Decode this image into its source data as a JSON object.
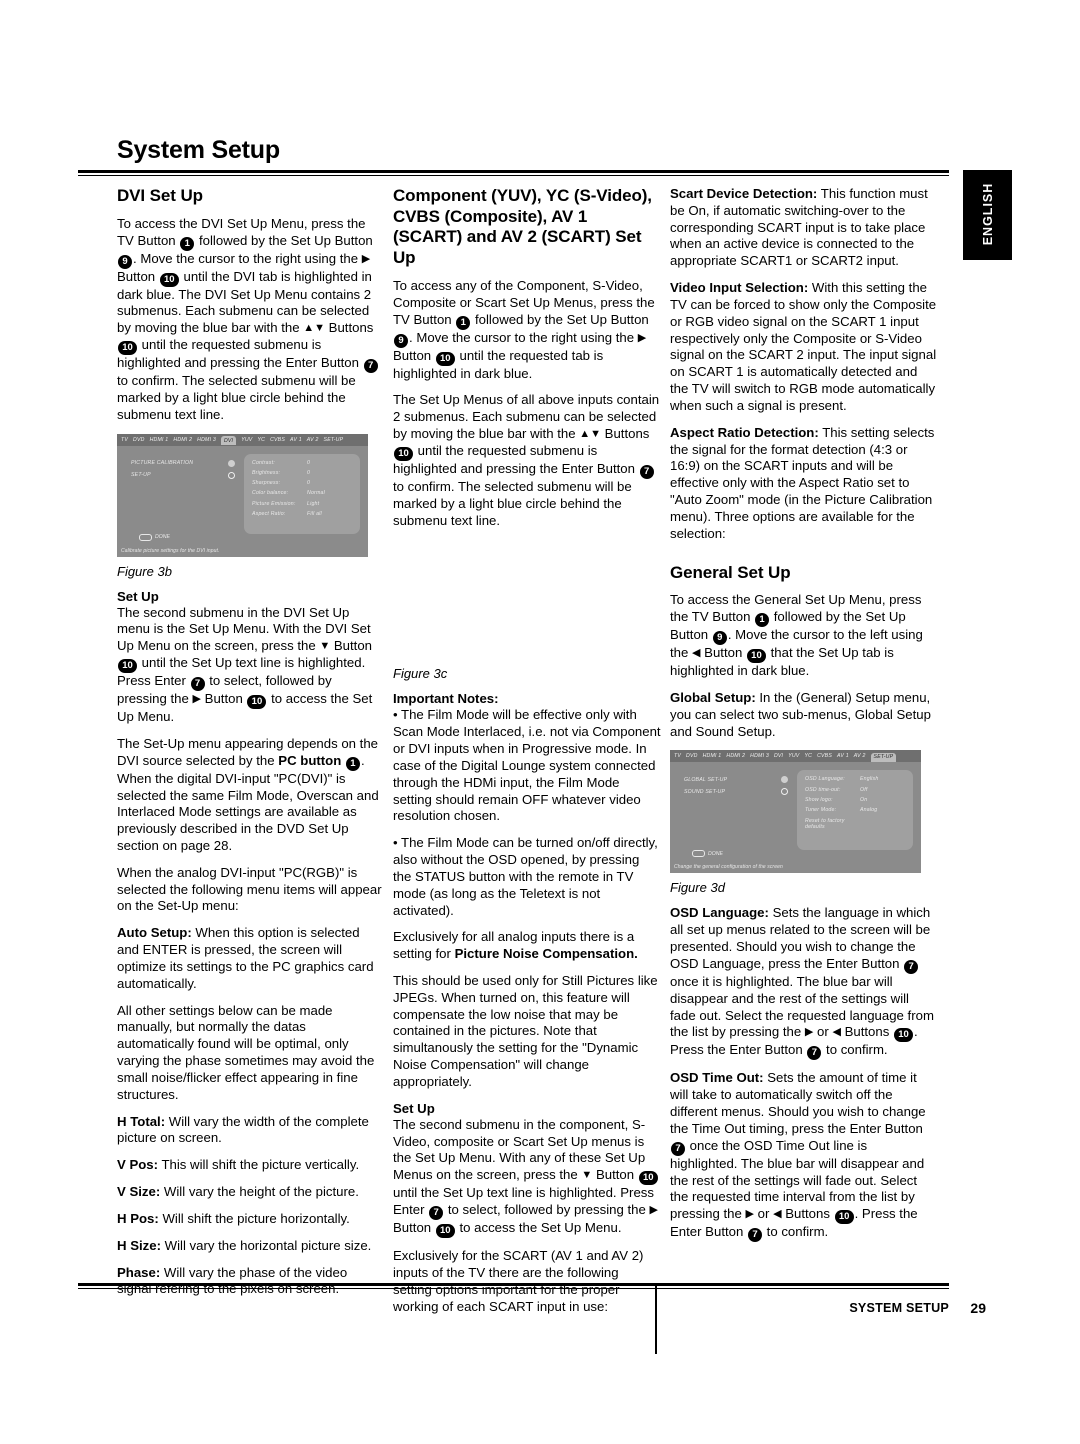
{
  "header": {
    "title": "System Setup",
    "language_tab": "ENGLISH"
  },
  "footer": {
    "label": "SYSTEM SETUP",
    "page_number": "29"
  },
  "column1": {
    "heading": "DVI Set Up",
    "p1_a": "To access the DVI Set Up Menu, press the TV Button",
    "p1_b": "followed by the Set Up Button",
    "p1_c": ". Move the cursor to the right using the",
    "p1_d": "Button",
    "p1_e": "until the DVI tab is highlighted in dark blue. The DVI Set Up Menu contains 2 submenus. Each submenu can be selected by moving the blue bar with the",
    "p1_f": "Buttons",
    "p1_g": "until the requested submenu is highlighted and pressing the Enter Button",
    "p1_h": "to confirm. The selected submenu will be marked by a light blue circle behind the submenu text line.",
    "figure_caption": "Figure 3b",
    "sub1_heading": "Set Up",
    "sub1_a": "The second submenu in the DVI Set Up menu is the Set Up Menu. With the DVI Set Up Menu on the screen, press the",
    "sub1_b": "Button",
    "sub1_c": "until the Set Up text line is highlighted. Press Enter",
    "sub1_d": "to select, followed by pressing the",
    "sub1_e": "Button",
    "sub1_f": "to access the Set Up Menu.",
    "p2_a": "The Set-Up menu appearing depends on the DVI source selected by the",
    "p2_bold": "PC button",
    "p2_b": ". When the digital DVI-input \"PC(DVI)\" is selected the same Film Mode, Overscan and Interlaced Mode settings are available as previously described in the DVD Set Up section on page 28.",
    "p3": "When the analog DVI-input \"PC(RGB)\" is selected the following menu items will appear on the Set-Up menu:",
    "p4_bold": "Auto Setup:",
    "p4": "When this option is selected and ENTER is pressed, the screen will optimize its settings to the PC graphics card automatically.",
    "p5": "All other settings below can be made manually, but normally the datas automatically found will be optimal, only varying the phase sometimes may avoid the small noise/flicker effect appearing in fine structures.",
    "p6_bold": "H Total:",
    "p6": "Will vary the width of the complete picture on screen.",
    "p7_bold": "V Pos:",
    "p7": "This will shift the picture vertically.",
    "p8_bold": "V Size:",
    "p8": "Will vary the height of the picture.",
    "p9_bold": "H Pos:",
    "p9": "Will shift the picture horizontally.",
    "p10_bold": "H Size:",
    "p10": "Will vary the horizontal picture size.",
    "p11_bold": "Phase:",
    "p11": "Will vary the phase of the video signal refering to the pixels on screen."
  },
  "column2": {
    "heading": "Component (YUV), YC (S-Video), CVBS (Composite), AV 1 (SCART) and AV 2 (SCART) Set Up",
    "p1_a": "To access any of the Component, S-Video, Composite or Scart Set Up Menus, press the TV Button",
    "p1_b": "followed by the Set Up Button",
    "p1_c": ". Move the cursor to the right using the",
    "p1_d": "Button",
    "p1_e": "until the requested tab is highlighted in dark blue.",
    "p2_a": "The Set Up Menus of all above inputs contain 2 submenus. Each submenu can be selected by moving the blue bar with the",
    "p2_b": "Buttons",
    "p2_c": "until the requested submenu is highlighted and pressing the Enter Button",
    "p2_d": "to confirm. The selected submenu will be marked by a light blue circle behind the submenu text line.",
    "figure_caption": "Figure 3c",
    "notes_heading": "Important Notes:",
    "note1": "• The Film Mode will be effective only with Scan Mode Interlaced, i.e. not via Component or DVI inputs when in Progressive mode. In case of the Digital Lounge system connected through the HDMi input, the Film Mode setting should remain OFF whatever video resolution chosen.",
    "note2": "• The Film Mode can be turned on/off directly, also without the OSD opened, by pressing the STATUS button with the remote in TV mode (as long as the Teletext is not activated).",
    "p3_a": "Exclusively for all analog inputs there is a setting for",
    "p3_bold": "Picture Noise Compensation.",
    "p4": "This should be used only for Still Pictures like JPEGs. When turned on, this feature will compensate the low noise that may be contained in the pictures. Note that simultanously the setting for the \"Dynamic Noise Compensation\" will change appropriately.",
    "sub_heading": "Set Up",
    "sub_a": "The second submenu in the component, S-Video, composite or Scart Set Up menus is the Set Up Menu. With any of these Set Up Menus on the screen, press the",
    "sub_b": "Button",
    "sub_c": "until the Set Up text line is highlighted. Press Enter",
    "sub_d": "to select, followed by pressing the",
    "sub_e": "Button",
    "sub_f": "to access the Set Up Menu.",
    "p5": "Exclusively for the SCART (AV 1 and AV 2) inputs of the TV there are the following setting options important for the proper working of each SCART input in use:"
  },
  "column3": {
    "p1_bold": "Scart Device Detection:",
    "p1": "This function must be On, if automatic switching-over to the corresponding SCART input is to take place when an active device is connected to the appropriate SCART1 or SCART2 input.",
    "p2_bold": "Video Input Selection:",
    "p2": "With this setting the TV can be forced to show only the Composite or RGB video signal on  the SCART 1 input respectively only the Composite or S-Video signal on the SCART 2 input. The input signal on SCART 1 is automatically detected and the TV will switch to RGB mode automatically when such a signal is present.",
    "p3_bold": "Aspect Ratio Detection:",
    "p3": "This setting selects the signal for the format detection (4:3 or 16:9) on the SCART inputs and will be effective only with the Aspect Ratio set to \"Auto Zoom\" mode (in the Picture Calibration menu). Three options are available for the selection:",
    "heading": "General Set Up",
    "p4_a": "To access the General Set Up Menu, press the TV Button",
    "p4_b": "followed by the Set Up Button",
    "p4_c": ". Move the cursor to the left using the",
    "p4_d": "Button",
    "p4_e": "that the Set Up tab is highlighted in dark blue.",
    "p5_bold": "Global Setup:",
    "p5": "In the (General) Setup menu, you can select two sub-menus, Global Setup and Sound Setup.",
    "figure_caption": "Figure 3d",
    "p6_bold": "OSD Language:",
    "p6_a": "Sets the language in which all set up menus related to the screen will be presented. Should you wish to change the OSD Language, press the Enter Button",
    "p6_b": "once it is highlighted. The blue bar will disappear and the rest of the settings will fade out. Select the requested language from the list by pressing the",
    "p6_c": "or",
    "p6_d": "Buttons",
    "p6_e": ". Press the Enter Button",
    "p6_f": "to confirm.",
    "p7_bold": "OSD Time Out:",
    "p7_a": "Sets the amount of time it will take to automatically switch off the different menus. Should you wish to change the Time Out timing, press the Enter Button",
    "p7_b": "once the OSD Time Out line is highlighted. The blue bar will disappear and the rest of the settings will fade out. Select the requested time interval from the list by pressing the",
    "p7_c": "or",
    "p7_d": "Buttons",
    "p7_e": ". Press the Enter Button",
    "p7_f": "to confirm."
  },
  "osd_dvi": {
    "tabs": [
      "TV",
      "DVD",
      "HDMI 1",
      "HDMI 2",
      "HDMI 3",
      "DVI",
      "YUV",
      "YC",
      "CVBS",
      "AV 1",
      "AV 2",
      "SET-UP"
    ],
    "active_tab": "DVI",
    "submenus": [
      {
        "label": "PICTURE CALIBRATION",
        "selected": true
      },
      {
        "label": "SET-UP",
        "selected": false
      }
    ],
    "settings": [
      {
        "name": "Contrast:",
        "value": "0"
      },
      {
        "name": "Brightness:",
        "value": "0"
      },
      {
        "name": "Sharpness:",
        "value": "0"
      },
      {
        "name": "Color balance:",
        "value": "Normal"
      },
      {
        "name": "Picture Emission:",
        "value": "Light"
      },
      {
        "name": "Aspect Ratio:",
        "value": "Fill all"
      }
    ],
    "done_label": "DONE",
    "status": "Calibrate picture settings for the DVI input."
  },
  "osd_general": {
    "tabs": [
      "TV",
      "DVD",
      "HDMI 1",
      "HDMI 2",
      "HDMI 3",
      "DVI",
      "YUV",
      "YC",
      "CVBS",
      "AV 1",
      "AV 2",
      "SET-UP"
    ],
    "active_tab": "SET-UP",
    "submenus": [
      {
        "label": "GLOBAL SET-UP",
        "selected": true
      },
      {
        "label": "SOUND SET-UP",
        "selected": false
      }
    ],
    "settings": [
      {
        "name": "OSD Language:",
        "value": "English"
      },
      {
        "name": "OSD time-out:",
        "value": "Off"
      },
      {
        "name": "Show logo:",
        "value": "On"
      },
      {
        "name": "Tuner Mode:",
        "value": "Analog"
      },
      {
        "name": "Reset to factory defaults",
        "value": ""
      }
    ],
    "done_label": "DONE",
    "status": "Change the general configuration of the screen"
  },
  "buttons": {
    "tv": "1",
    "setup": "9",
    "nav": "10",
    "enter": "7"
  },
  "glyphs": {
    "right": "▶",
    "left": "◀",
    "up": "▲",
    "down": "▼"
  }
}
